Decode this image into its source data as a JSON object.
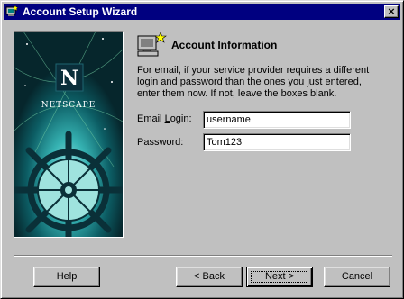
{
  "window": {
    "title": "Account Setup Wizard",
    "close_label": "×"
  },
  "banner": {
    "logo_letter": "N",
    "brand": "NETSCAPE"
  },
  "section": {
    "title": "Account Information",
    "icon": "computer-star-icon",
    "description": "For email, if your service provider requires a different login and password than the ones you just entered, enter them now.  If not, leave the boxes blank."
  },
  "form": {
    "email_login": {
      "label_prefix": "Email ",
      "label_accel": "L",
      "label_suffix": "ogin:",
      "value": "username"
    },
    "password": {
      "label": "Password:",
      "value": "Tom123"
    }
  },
  "buttons": {
    "help": "Help",
    "back": "< Back",
    "next": "Next >",
    "cancel": "Cancel"
  }
}
